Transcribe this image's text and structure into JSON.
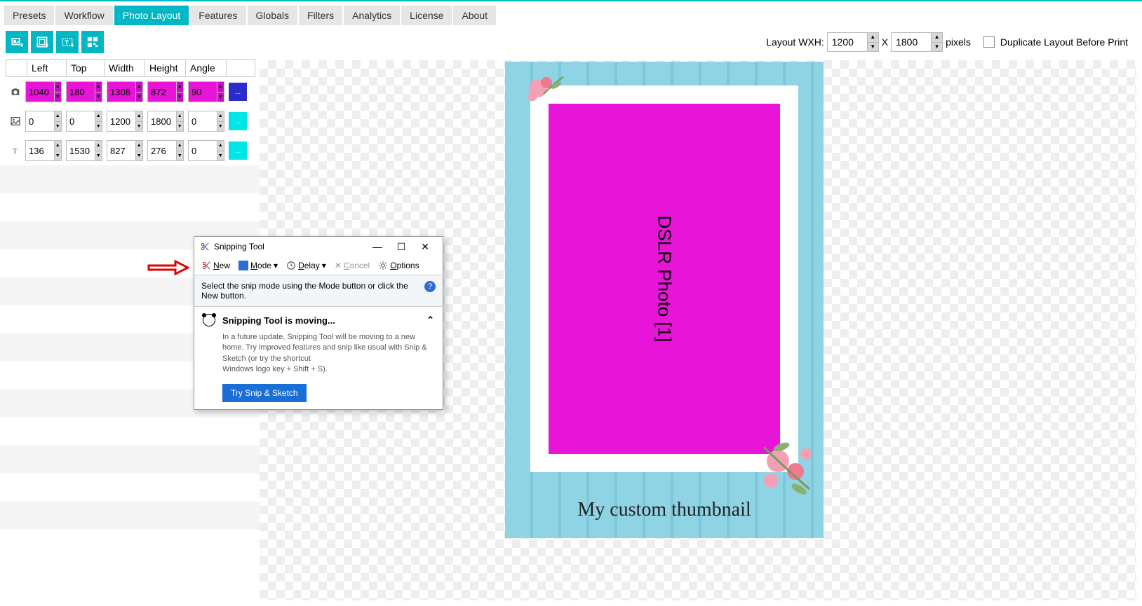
{
  "tabs": [
    "Presets",
    "Workflow",
    "Photo Layout",
    "Features",
    "Globals",
    "Filters",
    "Analytics",
    "License",
    "About"
  ],
  "active_tab_index": 2,
  "layout_wxh_label": "Layout WXH:",
  "layout_w": "1200",
  "layout_x_sep": "X",
  "layout_h": "1800",
  "pixels_label": "pixels",
  "duplicate_label": "Duplicate Layout Before Print",
  "headers": {
    "left": "Left",
    "top": "Top",
    "width": "Width",
    "height": "Height",
    "angle": "Angle"
  },
  "rows": [
    {
      "icon": "camera",
      "vals": [
        "1040",
        "180",
        "1308",
        "872",
        "90"
      ],
      "pink": true,
      "chip": "blue"
    },
    {
      "icon": "image",
      "vals": [
        "0",
        "0",
        "1200",
        "1800",
        "0"
      ],
      "pink": false,
      "chip": "cyan"
    },
    {
      "icon": "text",
      "vals": [
        "136",
        "1530",
        "827",
        "276",
        "0"
      ],
      "pink": false,
      "chip": "cyan"
    }
  ],
  "photo_label": "DSLR Photo [1]",
  "thumb_text": "My custom thumbnail",
  "snip": {
    "title": "Snipping Tool",
    "new": "New",
    "mode": "Mode",
    "delay": "Delay",
    "cancel": "Cancel",
    "options": "Options",
    "info": "Select the snip mode using the Mode button or click the New button.",
    "moving_hdr": "Snipping Tool is moving...",
    "moving_body1": "In a future update, Snipping Tool will be moving to a new home. Try improved features and snip like usual with Snip & Sketch (or try the shortcut",
    "moving_body2": "Windows logo key + Shift + S).",
    "try": "Try Snip & Sketch"
  }
}
